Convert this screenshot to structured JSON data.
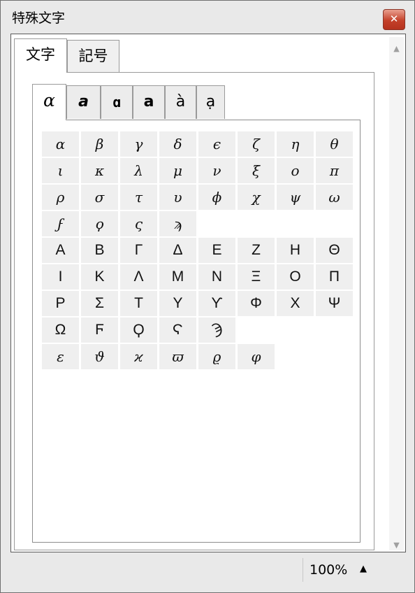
{
  "window": {
    "title": "特殊文字"
  },
  "outer_tabs": [
    {
      "label": "文字"
    },
    {
      "label": "記号"
    }
  ],
  "inner_tabs": [
    {
      "label": "α"
    },
    {
      "label": "a"
    },
    {
      "label": "ɑ"
    },
    {
      "label": "a"
    },
    {
      "label": "à"
    },
    {
      "label": "ạ"
    }
  ],
  "rows": [
    {
      "style": "lc",
      "chars": [
        "α",
        "β",
        "γ",
        "δ",
        "ϵ",
        "ζ",
        "η",
        "θ"
      ]
    },
    {
      "style": "lc",
      "chars": [
        "ι",
        "κ",
        "λ",
        "μ",
        "ν",
        "ξ",
        "ο",
        "π"
      ]
    },
    {
      "style": "lc",
      "chars": [
        "ρ",
        "σ",
        "τ",
        "υ",
        "ϕ",
        "χ",
        "ψ",
        "ω"
      ]
    },
    {
      "style": "lc",
      "chars": [
        "ϝ",
        "ϙ",
        "ς",
        "ϡ"
      ]
    },
    {
      "style": "uc",
      "chars": [
        "Α",
        "Β",
        "Γ",
        "Δ",
        "Ε",
        "Ζ",
        "Η",
        "Θ"
      ]
    },
    {
      "style": "uc",
      "chars": [
        "Ι",
        "Κ",
        "Λ",
        "Μ",
        "Ν",
        "Ξ",
        "Ο",
        "Π"
      ]
    },
    {
      "style": "uc",
      "chars": [
        "Ρ",
        "Σ",
        "Τ",
        "Υ",
        "ϒ",
        "Φ",
        "Χ",
        "Ψ"
      ]
    },
    {
      "style": "uc",
      "chars": [
        "Ω",
        "Ϝ",
        "Ϙ",
        "Ϛ",
        "Ϡ"
      ]
    },
    {
      "style": "lc",
      "chars": [
        "ε",
        "ϑ",
        "ϰ",
        "ϖ",
        "ϱ",
        "φ"
      ]
    }
  ],
  "status": {
    "zoom": "100%",
    "zoom_icon": "triangle-up-icon"
  },
  "colors": {
    "cell_bg": "#efefef",
    "close_button": "#c4412a"
  }
}
